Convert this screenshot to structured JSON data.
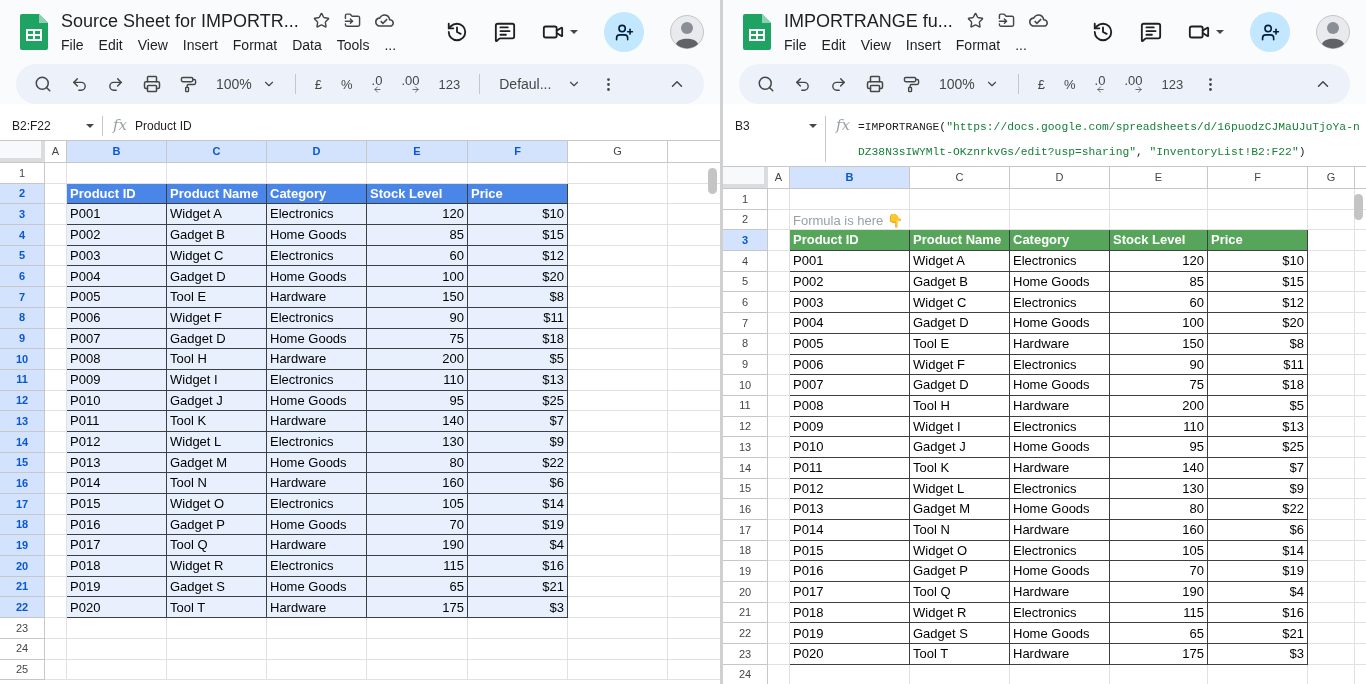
{
  "panes": [
    {
      "title": "Source Sheet for IMPORTR...",
      "menu": [
        "File",
        "Edit",
        "View",
        "Insert",
        "Format",
        "Data",
        "Tools",
        "..."
      ],
      "toolbar": {
        "zoom": "100%",
        "buttons": [
          {
            "label": "£",
            "kind": "plain"
          },
          {
            "label": "%",
            "kind": "plain"
          },
          {
            "label": ".0",
            "kind": "decrease"
          },
          {
            "label": ".00",
            "kind": "increase"
          },
          {
            "label": "123",
            "kind": "plain"
          }
        ],
        "font": "Defaul..."
      },
      "name_box": "B2:F22",
      "fx_label": "fx",
      "formula": [
        {
          "kind": "plain",
          "text": "Product ID"
        }
      ],
      "columns": [
        {
          "label": "A",
          "selected": false
        },
        {
          "label": "B",
          "selected": true
        },
        {
          "label": "C",
          "selected": true
        },
        {
          "label": "D",
          "selected": true
        },
        {
          "label": "E",
          "selected": true
        },
        {
          "label": "F",
          "selected": true
        },
        {
          "label": "G",
          "selected": false
        }
      ],
      "rows": [
        {
          "number": "1",
          "selected": false,
          "kind": "empty"
        },
        {
          "number": "2",
          "selected": true,
          "kind": "header",
          "color": "#4a86e8",
          "cells": [
            "Product ID",
            "Product Name",
            "Category",
            "Stock Level",
            "Price"
          ]
        },
        {
          "number": "3",
          "selected": true,
          "kind": "data",
          "cells": [
            "P001",
            "Widget A",
            "Electronics",
            "120",
            "$10"
          ]
        },
        {
          "number": "4",
          "selected": true,
          "kind": "data",
          "cells": [
            "P002",
            "Gadget B",
            "Home Goods",
            "85",
            "$15"
          ]
        },
        {
          "number": "5",
          "selected": true,
          "kind": "data",
          "cells": [
            "P003",
            "Widget C",
            "Electronics",
            "60",
            "$12"
          ]
        },
        {
          "number": "6",
          "selected": true,
          "kind": "data",
          "cells": [
            "P004",
            "Gadget D",
            "Home Goods",
            "100",
            "$20"
          ]
        },
        {
          "number": "7",
          "selected": true,
          "kind": "data",
          "cells": [
            "P005",
            "Tool E",
            "Hardware",
            "150",
            "$8"
          ]
        },
        {
          "number": "8",
          "selected": true,
          "kind": "data",
          "cells": [
            "P006",
            "Widget F",
            "Electronics",
            "90",
            "$11"
          ]
        },
        {
          "number": "9",
          "selected": true,
          "kind": "data",
          "cells": [
            "P007",
            "Gadget D",
            "Home Goods",
            "75",
            "$18"
          ]
        },
        {
          "number": "10",
          "selected": true,
          "kind": "data",
          "cells": [
            "P008",
            "Tool H",
            "Hardware",
            "200",
            "$5"
          ]
        },
        {
          "number": "11",
          "selected": true,
          "kind": "data",
          "cells": [
            "P009",
            "Widget I",
            "Electronics",
            "110",
            "$13"
          ]
        },
        {
          "number": "12",
          "selected": true,
          "kind": "data",
          "cells": [
            "P010",
            "Gadget J",
            "Home Goods",
            "95",
            "$25"
          ]
        },
        {
          "number": "13",
          "selected": true,
          "kind": "data",
          "cells": [
            "P011",
            "Tool K",
            "Hardware",
            "140",
            "$7"
          ]
        },
        {
          "number": "14",
          "selected": true,
          "kind": "data",
          "cells": [
            "P012",
            "Widget L",
            "Electronics",
            "130",
            "$9"
          ]
        },
        {
          "number": "15",
          "selected": true,
          "kind": "data",
          "cells": [
            "P013",
            "Gadget M",
            "Home Goods",
            "80",
            "$22"
          ]
        },
        {
          "number": "16",
          "selected": true,
          "kind": "data",
          "cells": [
            "P014",
            "Tool N",
            "Hardware",
            "160",
            "$6"
          ]
        },
        {
          "number": "17",
          "selected": true,
          "kind": "data",
          "cells": [
            "P015",
            "Widget O",
            "Electronics",
            "105",
            "$14"
          ]
        },
        {
          "number": "18",
          "selected": true,
          "kind": "data",
          "cells": [
            "P016",
            "Gadget P",
            "Home Goods",
            "70",
            "$19"
          ]
        },
        {
          "number": "19",
          "selected": true,
          "kind": "data",
          "cells": [
            "P017",
            "Tool Q",
            "Hardware",
            "190",
            "$4"
          ]
        },
        {
          "number": "20",
          "selected": true,
          "kind": "data",
          "cells": [
            "P018",
            "Widget R",
            "Electronics",
            "115",
            "$16"
          ]
        },
        {
          "number": "21",
          "selected": true,
          "kind": "data",
          "cells": [
            "P019",
            "Gadget S",
            "Home Goods",
            "65",
            "$21"
          ]
        },
        {
          "number": "22",
          "selected": true,
          "kind": "data",
          "cells": [
            "P020",
            "Tool T",
            "Hardware",
            "175",
            "$3"
          ]
        },
        {
          "number": "23",
          "selected": false,
          "kind": "empty"
        },
        {
          "number": "24",
          "selected": false,
          "kind": "empty"
        },
        {
          "number": "25",
          "selected": false,
          "kind": "empty"
        }
      ]
    },
    {
      "title": "IMPORTRANGE fu...",
      "menu": [
        "File",
        "Edit",
        "View",
        "Insert",
        "Format",
        "..."
      ],
      "toolbar": {
        "zoom": "100%",
        "buttons": [
          {
            "label": "£",
            "kind": "plain"
          },
          {
            "label": "%",
            "kind": "plain"
          },
          {
            "label": ".0",
            "kind": "decrease"
          },
          {
            "label": ".00",
            "kind": "increase"
          },
          {
            "label": "123",
            "kind": "plain"
          }
        ]
      },
      "name_box": "B3",
      "fx_label": "fx",
      "formula": [
        {
          "kind": "function",
          "text": "=IMPORTRANGE("
        },
        {
          "kind": "string",
          "text": "\"https://docs.google.com/spreadsheets/d/16puodzCJMaUJuTjoYa-nDZ38N3sIWYMlt-OKznrkvGs/edit?usp=sharing\""
        },
        {
          "kind": "function",
          "text": ", "
        },
        {
          "kind": "string",
          "text": "\"InventoryList!B2:F22\""
        },
        {
          "kind": "function",
          "text": ")"
        }
      ],
      "columns": [
        {
          "label": "A",
          "selected": false
        },
        {
          "label": "B",
          "selected": true
        },
        {
          "label": "C",
          "selected": false
        },
        {
          "label": "D",
          "selected": false
        },
        {
          "label": "E",
          "selected": false
        },
        {
          "label": "F",
          "selected": false
        },
        {
          "label": "G",
          "selected": false
        }
      ],
      "rows": [
        {
          "number": "1",
          "selected": false,
          "kind": "empty"
        },
        {
          "number": "2",
          "selected": false,
          "kind": "note",
          "text": "Formula is here 👇"
        },
        {
          "number": "3",
          "selected": true,
          "kind": "header",
          "color": "#57a55a",
          "cells": [
            "Product ID",
            "Product Name",
            "Category",
            "Stock Level",
            "Price"
          ]
        },
        {
          "number": "4",
          "selected": false,
          "kind": "data",
          "cells": [
            "P001",
            "Widget A",
            "Electronics",
            "120",
            "$10"
          ]
        },
        {
          "number": "5",
          "selected": false,
          "kind": "data",
          "cells": [
            "P002",
            "Gadget B",
            "Home Goods",
            "85",
            "$15"
          ]
        },
        {
          "number": "6",
          "selected": false,
          "kind": "data",
          "cells": [
            "P003",
            "Widget C",
            "Electronics",
            "60",
            "$12"
          ]
        },
        {
          "number": "7",
          "selected": false,
          "kind": "data",
          "cells": [
            "P004",
            "Gadget D",
            "Home Goods",
            "100",
            "$20"
          ]
        },
        {
          "number": "8",
          "selected": false,
          "kind": "data",
          "cells": [
            "P005",
            "Tool E",
            "Hardware",
            "150",
            "$8"
          ]
        },
        {
          "number": "9",
          "selected": false,
          "kind": "data",
          "cells": [
            "P006",
            "Widget F",
            "Electronics",
            "90",
            "$11"
          ]
        },
        {
          "number": "10",
          "selected": false,
          "kind": "data",
          "cells": [
            "P007",
            "Gadget D",
            "Home Goods",
            "75",
            "$18"
          ]
        },
        {
          "number": "11",
          "selected": false,
          "kind": "data",
          "cells": [
            "P008",
            "Tool H",
            "Hardware",
            "200",
            "$5"
          ]
        },
        {
          "number": "12",
          "selected": false,
          "kind": "data",
          "cells": [
            "P009",
            "Widget I",
            "Electronics",
            "110",
            "$13"
          ]
        },
        {
          "number": "13",
          "selected": false,
          "kind": "data",
          "cells": [
            "P010",
            "Gadget J",
            "Home Goods",
            "95",
            "$25"
          ]
        },
        {
          "number": "14",
          "selected": false,
          "kind": "data",
          "cells": [
            "P011",
            "Tool K",
            "Hardware",
            "140",
            "$7"
          ]
        },
        {
          "number": "15",
          "selected": false,
          "kind": "data",
          "cells": [
            "P012",
            "Widget L",
            "Electronics",
            "130",
            "$9"
          ]
        },
        {
          "number": "16",
          "selected": false,
          "kind": "data",
          "cells": [
            "P013",
            "Gadget M",
            "Home Goods",
            "80",
            "$22"
          ]
        },
        {
          "number": "17",
          "selected": false,
          "kind": "data",
          "cells": [
            "P014",
            "Tool N",
            "Hardware",
            "160",
            "$6"
          ]
        },
        {
          "number": "18",
          "selected": false,
          "kind": "data",
          "cells": [
            "P015",
            "Widget O",
            "Electronics",
            "105",
            "$14"
          ]
        },
        {
          "number": "19",
          "selected": false,
          "kind": "data",
          "cells": [
            "P016",
            "Gadget P",
            "Home Goods",
            "70",
            "$19"
          ]
        },
        {
          "number": "20",
          "selected": false,
          "kind": "data",
          "cells": [
            "P017",
            "Tool Q",
            "Hardware",
            "190",
            "$4"
          ]
        },
        {
          "number": "21",
          "selected": false,
          "kind": "data",
          "cells": [
            "P018",
            "Widget R",
            "Electronics",
            "115",
            "$16"
          ]
        },
        {
          "number": "22",
          "selected": false,
          "kind": "data",
          "cells": [
            "P019",
            "Gadget S",
            "Home Goods",
            "65",
            "$21"
          ]
        },
        {
          "number": "23",
          "selected": false,
          "kind": "data",
          "cells": [
            "P020",
            "Tool T",
            "Hardware",
            "175",
            "$3"
          ]
        },
        {
          "number": "24",
          "selected": false,
          "kind": "empty"
        }
      ]
    }
  ]
}
